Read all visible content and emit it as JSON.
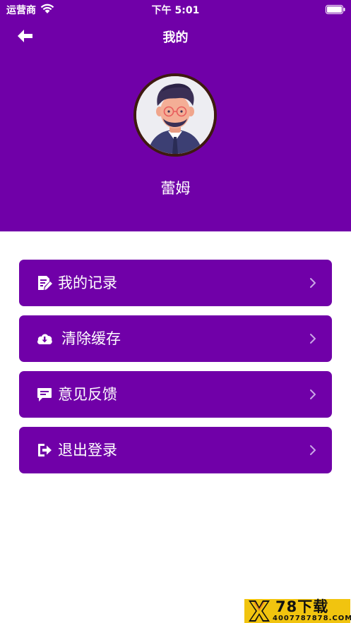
{
  "status_bar": {
    "carrier": "运营商",
    "time": "下午 5:01"
  },
  "header": {
    "title": "我的",
    "user_name": "蕾姆",
    "background_color": "#7000A8"
  },
  "menu": {
    "items": [
      {
        "label": "我的记录",
        "icon": "edit-note-icon"
      },
      {
        "label": "清除缓存",
        "icon": "cloud-download-icon"
      },
      {
        "label": "意见反馈",
        "icon": "feedback-message-icon"
      },
      {
        "label": "退出登录",
        "icon": "logout-icon"
      }
    ]
  },
  "watermark": {
    "title": "78下载",
    "phone": "4007787878.COM",
    "color": "#F1C40F"
  }
}
